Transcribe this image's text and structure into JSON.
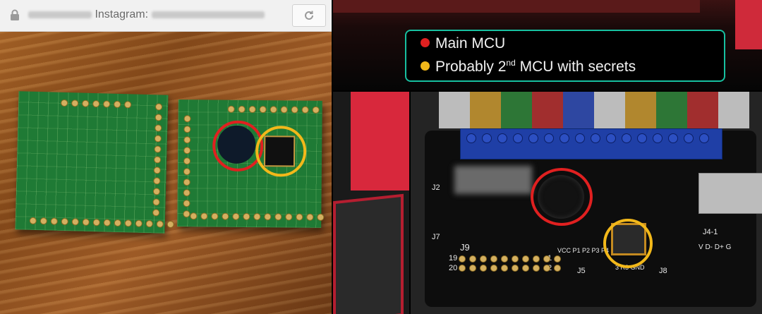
{
  "browser": {
    "url_text": "Instagram:",
    "icons": {
      "lock": "lock-icon",
      "reload": "reload-icon"
    }
  },
  "legend": {
    "items": [
      {
        "label": "Main MCU",
        "color": "#e02020"
      },
      {
        "label": "Probably 2",
        "sup": "nd",
        "rest": " MCU with secrets",
        "color": "#f2b81a"
      }
    ]
  },
  "board_labels": {
    "j9": "J9",
    "pin19": "19",
    "pin20": "20",
    "pin1": "1",
    "pin2": "2",
    "j2": "J2",
    "j7": "J7",
    "j5": "J5",
    "j8": "J8",
    "j4": "J4-1",
    "vcc_row": "VCC P1 P2 P3 P4",
    "gnd_row": "3 R3 GND",
    "usb_pins": "V D- D+ G"
  },
  "colors": {
    "main_mcu_ring": "#e02020",
    "secondary_mcu_ring": "#f2b81a",
    "legend_border": "#17c0a0"
  }
}
